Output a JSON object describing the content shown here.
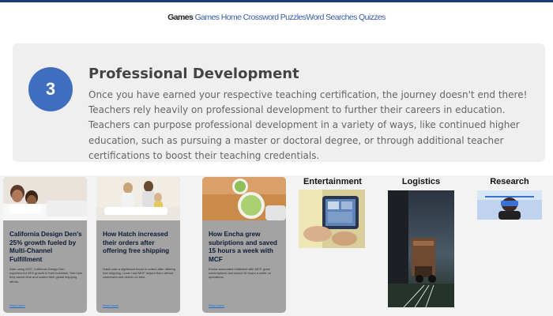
{
  "topnav": {
    "items": [
      "Games",
      "Games Home",
      "Crossword Puzzles",
      "Word Searches",
      "Quizzes"
    ]
  },
  "dev": {
    "step_number": "3",
    "title": "Professional Development",
    "body": "Once you have earned your respective teaching certification, the journey doesn't end there! Teachers rely heavily on professional development to further their careers in education. Teachers can purpose professional development in a variety of ways, like continued higher education, such as pursuing a master or doctoral degree, or through additional teacher certifications to boost their teaching credentials."
  },
  "cases": [
    {
      "title": "California Design Den's 25% growth fueled by Multi-Channel Fulfillment",
      "desc": "After using MCF, California Design Den experienced 25% growth in their business. See how they saved time and scaled their global shipping efforts.",
      "link": "Read more",
      "image": "family-in-bed"
    },
    {
      "title": "How Hatch increased their orders after offering free shipping",
      "desc": "Hatch saw a significant boost in orders after offering free shipping. Learn how MCF helped them attract customers and deliver on time.",
      "link": "Read more",
      "image": "family-on-couch"
    },
    {
      "title": "How Encha grew subriptions and saved 15 hours a week with MCF",
      "desc": "Encha automated fulfillment with MCF, grew subscriptions and saved 15 hours a week on operations.",
      "link": "Read more",
      "image": "matcha-tea"
    }
  ],
  "categories": [
    {
      "label": "Entertainment",
      "image": "tablet-in-hands"
    },
    {
      "label": "Logistics",
      "image": "truck-at-night"
    },
    {
      "label": "Research",
      "image": "person-with-vr-headset"
    }
  ],
  "colors": {
    "step_circle": "#3f6ebf",
    "card_bg": "#efefef",
    "case_card_bg": "#a3a3a3",
    "nav_link": "#3a5aa8"
  }
}
